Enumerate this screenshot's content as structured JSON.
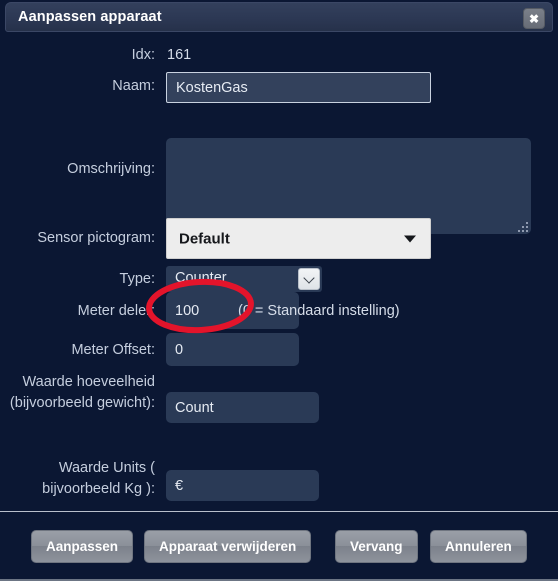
{
  "window": {
    "title": "Aanpassen apparaat",
    "close_label": "✖",
    "accent_red": "#e3142b",
    "titlebar_color": "#2c3854",
    "body_color": "#0b1733",
    "field_color": "#2a3a56"
  },
  "form": {
    "idx": {
      "label": "Idx:",
      "value": "161"
    },
    "naam": {
      "label": "Naam:",
      "value": "KostenGas",
      "placeholder": ""
    },
    "omschrijving": {
      "label": "Omschrijving:",
      "value": "",
      "placeholder": ""
    },
    "sensor_pictogram": {
      "label": "Sensor pictogram:",
      "value": "Default"
    },
    "type": {
      "label": "Type:",
      "value": "Counter"
    },
    "meter_deler": {
      "label": "Meter deler:",
      "value": "100",
      "hint": "(0 = Standaard instelling)"
    },
    "meter_offset": {
      "label": "Meter Offset:",
      "value": "0"
    },
    "waarde_hoeveelheid": {
      "label": "Waarde hoeveelheid (bijvoorbeeld gewicht):",
      "value": "Count"
    },
    "waarde_units": {
      "label": "Waarde Units ( bijvoorbeeld Kg ):",
      "value": "€"
    }
  },
  "footer": {
    "buttons": [
      {
        "label": "Aanpassen"
      },
      {
        "label": "Apparaat verwijderen"
      },
      {
        "label": "Vervang"
      },
      {
        "label": "Annuleren"
      }
    ]
  }
}
